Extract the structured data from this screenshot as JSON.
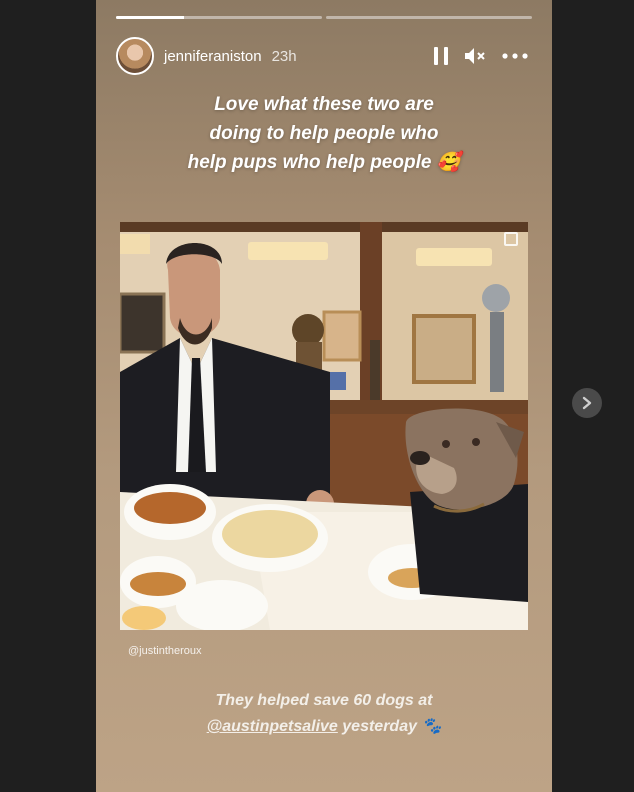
{
  "story": {
    "progress": [
      0.33,
      0
    ],
    "username": "jenniferaniston",
    "time": "23h",
    "caption_lines": [
      "Love what these two are",
      "doing to help people who",
      "help pups who help people"
    ],
    "caption_emoji": "🥰",
    "photo_credit": "@justintheroux",
    "bottom_caption_line1": "They helped save 60 dogs at",
    "bottom_mention": "@austinpetsalive",
    "bottom_caption_rest": " yesterday",
    "bottom_emoji": "🐾"
  },
  "controls": {
    "pause_icon": "pause-icon",
    "mute_icon": "speaker-muted-icon",
    "more_icon": "more-options-icon",
    "next_icon": "chevron-right-icon"
  },
  "colors": {
    "background": "#1f1f1f",
    "story_gradient_top": "#8d7a63",
    "story_gradient_bottom": "#bda386",
    "text": "#ffffff"
  }
}
